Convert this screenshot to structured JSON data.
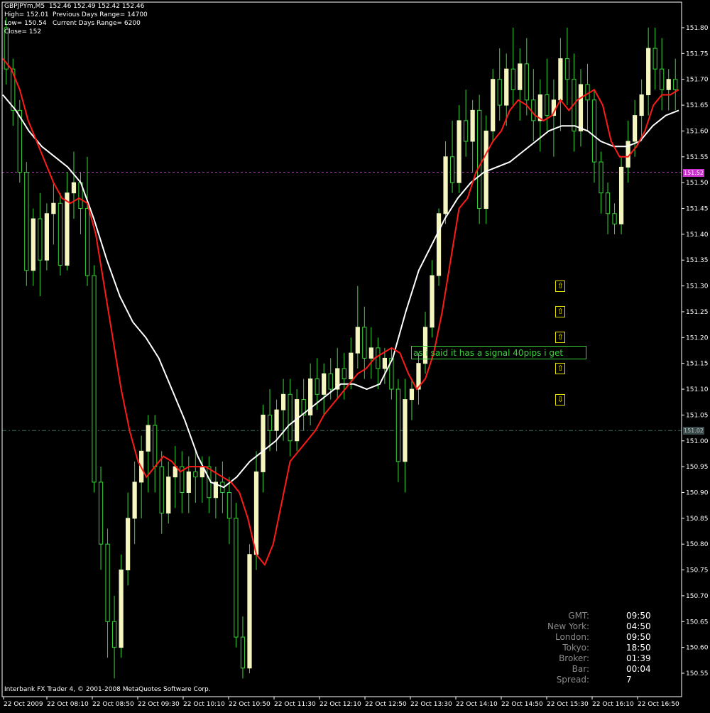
{
  "header": {
    "symbol": "GBPJPYm,M5",
    "ohlc": "152.46 152.49 152.42 152.46",
    "high": "High= 152.01",
    "low": "Low= 150.54",
    "close": "Close= 152",
    "prev_range": "Previous Days Range= 14700",
    "curr_range": "Current Days Range= 6200"
  },
  "footer_text": "Interbank FX Trader 4, © 2001-2008 MetaQuotes Software Corp.",
  "annotation_text": "as i said it has a signal 40pips i get",
  "price_tags": [
    {
      "label": "151.52",
      "bg": "#cc33cc",
      "color": "#ffffff",
      "price": 151.52
    },
    {
      "label": "151.02",
      "bg": "#3a4a4a",
      "color": "#c0c0c0",
      "price": 151.02
    }
  ],
  "clock": [
    {
      "label": "GMT:",
      "value": "09:50"
    },
    {
      "label": "New York:",
      "value": "04:50"
    },
    {
      "label": "London:",
      "value": "09:50"
    },
    {
      "label": "Tokyo:",
      "value": "18:50"
    },
    {
      "label": "Broker:",
      "value": "01:39"
    },
    {
      "label": "Bar:",
      "value": "00:04"
    },
    {
      "label": "Spread:",
      "value": "7"
    }
  ],
  "arrows": [
    {
      "symbol": "⇧",
      "price": 151.3,
      "index": 82
    },
    {
      "symbol": "⇧",
      "price": 151.25,
      "index": 82
    },
    {
      "symbol": "⇧",
      "price": 151.2,
      "index": 82
    },
    {
      "symbol": "⇧",
      "price": 151.14,
      "index": 82
    },
    {
      "symbol": "⇩",
      "price": 151.08,
      "index": 82
    }
  ],
  "colors": {
    "background": "#000000",
    "bull_body": "#f5f5c0",
    "wick": "#39d539",
    "bear_body": "#000000",
    "ma_fast": "#ff1a1a",
    "ma_slow": "#ffffff",
    "level_magenta": "#cc33cc",
    "level_gray": "#3a6a5a",
    "axis": "#ffffff",
    "arrow": "#e8e100"
  },
  "chart_data": {
    "type": "candlestick",
    "title": "GBPJPYm,M5",
    "ylim": [
      150.51,
      152.01
    ],
    "y_ticks": [
      "151.80",
      "151.75",
      "151.70",
      "151.65",
      "151.60",
      "151.55",
      "151.50",
      "151.45",
      "151.40",
      "151.35",
      "151.30",
      "151.25",
      "151.20",
      "151.15",
      "151.10",
      "151.05",
      "151.00",
      "150.95",
      "150.90",
      "150.85",
      "150.80",
      "150.75",
      "150.70",
      "150.65",
      "150.60",
      "150.55"
    ],
    "x_ticks": [
      "22 Oct 2009",
      "22 Oct 08:10",
      "22 Oct 08:50",
      "22 Oct 09:30",
      "22 Oct 10:10",
      "22 Oct 10:50",
      "22 Oct 11:30",
      "22 Oct 12:10",
      "22 Oct 12:50",
      "22 Oct 13:30",
      "22 Oct 14:10",
      "22 Oct 14:50",
      "22 Oct 15:30",
      "22 Oct 16:10",
      "22 Oct 16:50"
    ],
    "levels": [
      151.52,
      151.02
    ],
    "candles": [
      [
        151.8,
        151.82,
        151.69,
        151.72
      ],
      [
        151.72,
        151.74,
        151.61,
        151.64
      ],
      [
        151.64,
        151.66,
        151.5,
        151.52
      ],
      [
        151.52,
        151.54,
        151.3,
        151.33
      ],
      [
        151.33,
        151.45,
        151.3,
        151.43
      ],
      [
        151.43,
        151.48,
        151.28,
        151.35
      ],
      [
        151.35,
        151.46,
        151.33,
        151.44
      ],
      [
        151.44,
        151.5,
        151.38,
        151.46
      ],
      [
        151.46,
        151.48,
        151.32,
        151.34
      ],
      [
        151.34,
        151.52,
        151.33,
        151.48
      ],
      [
        151.48,
        151.56,
        151.43,
        151.5
      ],
      [
        151.5,
        151.52,
        151.4,
        151.45
      ],
      [
        151.45,
        151.55,
        151.3,
        151.32
      ],
      [
        151.32,
        151.34,
        150.9,
        150.92
      ],
      [
        150.92,
        150.95,
        150.75,
        150.8
      ],
      [
        150.8,
        150.83,
        150.58,
        150.65
      ],
      [
        150.65,
        150.7,
        150.54,
        150.6
      ],
      [
        150.6,
        150.78,
        150.58,
        150.75
      ],
      [
        150.75,
        150.9,
        150.72,
        150.85
      ],
      [
        150.85,
        150.96,
        150.8,
        150.92
      ],
      [
        150.92,
        151.01,
        150.85,
        150.98
      ],
      [
        150.98,
        151.05,
        150.9,
        151.03
      ],
      [
        151.03,
        151.05,
        150.9,
        150.95
      ],
      [
        150.95,
        150.98,
        150.82,
        150.86
      ],
      [
        150.86,
        150.96,
        150.84,
        150.93
      ],
      [
        150.93,
        150.99,
        150.87,
        150.95
      ],
      [
        150.95,
        150.98,
        150.86,
        150.9
      ],
      [
        150.9,
        150.97,
        150.86,
        150.94
      ],
      [
        150.94,
        150.98,
        150.88,
        150.93
      ],
      [
        150.93,
        150.97,
        150.88,
        150.95
      ],
      [
        150.95,
        150.97,
        150.86,
        150.89
      ],
      [
        150.89,
        150.95,
        150.85,
        150.92
      ],
      [
        150.92,
        150.96,
        150.86,
        150.9
      ],
      [
        150.9,
        150.93,
        150.8,
        150.85
      ],
      [
        150.85,
        150.88,
        150.6,
        150.62
      ],
      [
        150.62,
        150.66,
        150.54,
        150.56
      ],
      [
        150.56,
        150.8,
        150.55,
        150.78
      ],
      [
        150.78,
        150.98,
        150.75,
        150.94
      ],
      [
        150.94,
        151.07,
        150.9,
        151.05
      ],
      [
        151.05,
        151.1,
        150.98,
        151.02
      ],
      [
        151.02,
        151.08,
        150.98,
        151.06
      ],
      [
        151.06,
        151.12,
        151.0,
        151.09
      ],
      [
        151.09,
        151.12,
        150.97,
        151.0
      ],
      [
        151.0,
        151.1,
        150.98,
        151.08
      ],
      [
        151.08,
        151.12,
        151.02,
        151.05
      ],
      [
        151.05,
        151.15,
        151.03,
        151.12
      ],
      [
        151.12,
        151.16,
        151.06,
        151.09
      ],
      [
        151.09,
        151.15,
        151.05,
        151.13
      ],
      [
        151.13,
        151.16,
        151.08,
        151.1
      ],
      [
        151.1,
        151.18,
        151.08,
        151.14
      ],
      [
        151.14,
        151.17,
        151.08,
        151.12
      ],
      [
        151.12,
        151.2,
        151.1,
        151.17
      ],
      [
        151.17,
        151.3,
        151.14,
        151.22
      ],
      [
        151.22,
        151.26,
        151.12,
        151.16
      ],
      [
        151.16,
        151.22,
        151.12,
        151.18
      ],
      [
        151.18,
        151.2,
        151.1,
        151.14
      ],
      [
        151.14,
        151.18,
        151.11,
        151.16
      ],
      [
        151.16,
        151.18,
        151.08,
        151.1
      ],
      [
        151.1,
        151.12,
        150.92,
        150.96
      ],
      [
        150.96,
        151.12,
        150.9,
        151.08
      ],
      [
        151.08,
        151.12,
        151.04,
        151.1
      ],
      [
        151.1,
        151.17,
        151.07,
        151.15
      ],
      [
        151.15,
        151.25,
        151.13,
        151.22
      ],
      [
        151.22,
        151.35,
        151.2,
        151.32
      ],
      [
        151.32,
        151.45,
        151.3,
        151.44
      ],
      [
        151.44,
        151.58,
        151.42,
        151.55
      ],
      [
        151.55,
        151.62,
        151.48,
        151.5
      ],
      [
        151.5,
        151.65,
        151.48,
        151.62
      ],
      [
        151.62,
        151.68,
        151.55,
        151.58
      ],
      [
        151.58,
        151.66,
        151.52,
        151.64
      ],
      [
        151.64,
        151.67,
        151.42,
        151.45
      ],
      [
        151.45,
        151.63,
        151.42,
        151.6
      ],
      [
        151.6,
        151.72,
        151.58,
        151.7
      ],
      [
        151.7,
        151.76,
        151.62,
        151.65
      ],
      [
        151.65,
        151.75,
        151.61,
        151.72
      ],
      [
        151.72,
        151.8,
        151.65,
        151.68
      ],
      [
        151.68,
        151.76,
        151.62,
        151.73
      ],
      [
        151.73,
        151.78,
        151.63,
        151.66
      ],
      [
        151.66,
        151.72,
        151.58,
        151.62
      ],
      [
        151.62,
        151.7,
        151.56,
        151.67
      ],
      [
        151.67,
        151.74,
        151.6,
        151.63
      ],
      [
        151.63,
        151.7,
        151.55,
        151.66
      ],
      [
        151.66,
        151.78,
        151.6,
        151.74
      ],
      [
        151.74,
        151.8,
        151.65,
        151.7
      ],
      [
        151.7,
        151.75,
        151.56,
        151.6
      ],
      [
        151.6,
        151.72,
        151.57,
        151.69
      ],
      [
        151.69,
        151.73,
        151.6,
        151.66
      ],
      [
        151.66,
        151.68,
        151.5,
        151.54
      ],
      [
        151.54,
        151.56,
        151.44,
        151.48
      ],
      [
        151.48,
        151.5,
        151.4,
        151.44
      ],
      [
        151.44,
        151.46,
        151.4,
        151.42
      ],
      [
        151.42,
        151.55,
        151.4,
        151.53
      ],
      [
        151.53,
        151.62,
        151.5,
        151.58
      ],
      [
        151.58,
        151.66,
        151.55,
        151.63
      ],
      [
        151.63,
        151.7,
        151.58,
        151.67
      ],
      [
        151.67,
        151.8,
        151.63,
        151.76
      ],
      [
        151.76,
        151.8,
        151.68,
        151.72
      ],
      [
        151.72,
        151.78,
        151.64,
        151.68
      ],
      [
        151.68,
        151.72,
        151.64,
        151.7
      ],
      [
        151.7,
        151.74,
        151.64,
        151.68
      ]
    ],
    "ma_fast": [
      151.74,
      151.72,
      151.68,
      151.62,
      151.58,
      151.54,
      151.5,
      151.47,
      151.46,
      151.47,
      151.46,
      151.4,
      151.3,
      151.2,
      151.1,
      151.02,
      150.96,
      150.93,
      150.95,
      150.97,
      150.96,
      150.94,
      150.95,
      150.95,
      150.95,
      150.94,
      150.93,
      150.92,
      150.9,
      150.85,
      150.78,
      150.76,
      150.8,
      150.88,
      150.96,
      150.98,
      151.0,
      151.02,
      151.05,
      151.07,
      151.09,
      151.11,
      151.13,
      151.14,
      151.16,
      151.17,
      151.18,
      151.17,
      151.13,
      151.1,
      151.12,
      151.17,
      151.25,
      151.35,
      151.45,
      151.47,
      151.52,
      151.55,
      151.58,
      151.6,
      151.64,
      151.66,
      151.65,
      151.63,
      151.62,
      151.63,
      151.66,
      151.64,
      151.66,
      151.67,
      151.68,
      151.65,
      151.58,
      151.55,
      151.55,
      151.57,
      151.6,
      151.65,
      151.67,
      151.67,
      151.68
    ],
    "ma_slow": [
      151.67,
      151.64,
      151.6,
      151.57,
      151.55,
      151.53,
      151.5,
      151.43,
      151.35,
      151.28,
      151.23,
      151.2,
      151.16,
      151.1,
      151.04,
      150.97,
      150.92,
      150.91,
      150.93,
      150.96,
      150.98,
      151.0,
      151.03,
      151.05,
      151.07,
      151.09,
      151.11,
      151.11,
      151.1,
      151.11,
      151.16,
      151.25,
      151.33,
      151.38,
      151.43,
      151.47,
      151.5,
      151.52,
      151.53,
      151.54,
      151.56,
      151.58,
      151.6,
      151.61,
      151.61,
      151.6,
      151.58,
      151.57,
      151.57,
      151.58,
      151.61,
      151.63,
      151.64
    ]
  }
}
